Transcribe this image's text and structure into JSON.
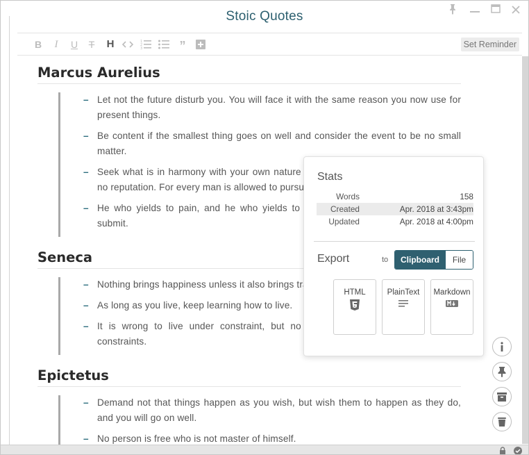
{
  "window": {
    "title": "Stoic Quotes"
  },
  "toolbar": {
    "reminder_label": "Set Reminder"
  },
  "sections": [
    {
      "author": "Marcus Aurelius",
      "quotes": [
        "Let not the future disturb you. You will face it with the same reason you now use for present things.",
        "Be content if the smallest thing goes on well and consider the event to be no small matter.",
        "Seek what is in harmony with your own nature and pursue it, even though it brings no reputation. For every man is allowed to pursue his own good.",
        "He who yields to pain, and he who yields to pleasure, it is the same; they both submit."
      ]
    },
    {
      "author": "Seneca",
      "quotes": [
        "Nothing brings happiness unless it also brings tranquility.",
        "As long as you live, keep learning how to live.",
        "It is wrong to live under constraint, but no man is constrained to live under constraints."
      ]
    },
    {
      "author": "Epictetus",
      "quotes": [
        "Demand not that things happen as you wish, but wish them to happen as they do, and you will go on well.",
        "No person is free who is not master of himself."
      ]
    }
  ],
  "stats": {
    "heading": "Stats",
    "words_label": "Words",
    "words_value": "158",
    "created_label": "Created",
    "created_value": "Apr. 2018 at 3:43pm",
    "updated_label": "Updated",
    "updated_value": "Apr. 2018 at 4:00pm"
  },
  "export": {
    "heading": "Export",
    "to_label": "to",
    "clipboard_label": "Clipboard",
    "file_label": "File",
    "formats": [
      "HTML",
      "PlainText",
      "Markdown"
    ]
  },
  "colors": {
    "accent": "#2f6070",
    "title": "#2c5f6f"
  }
}
